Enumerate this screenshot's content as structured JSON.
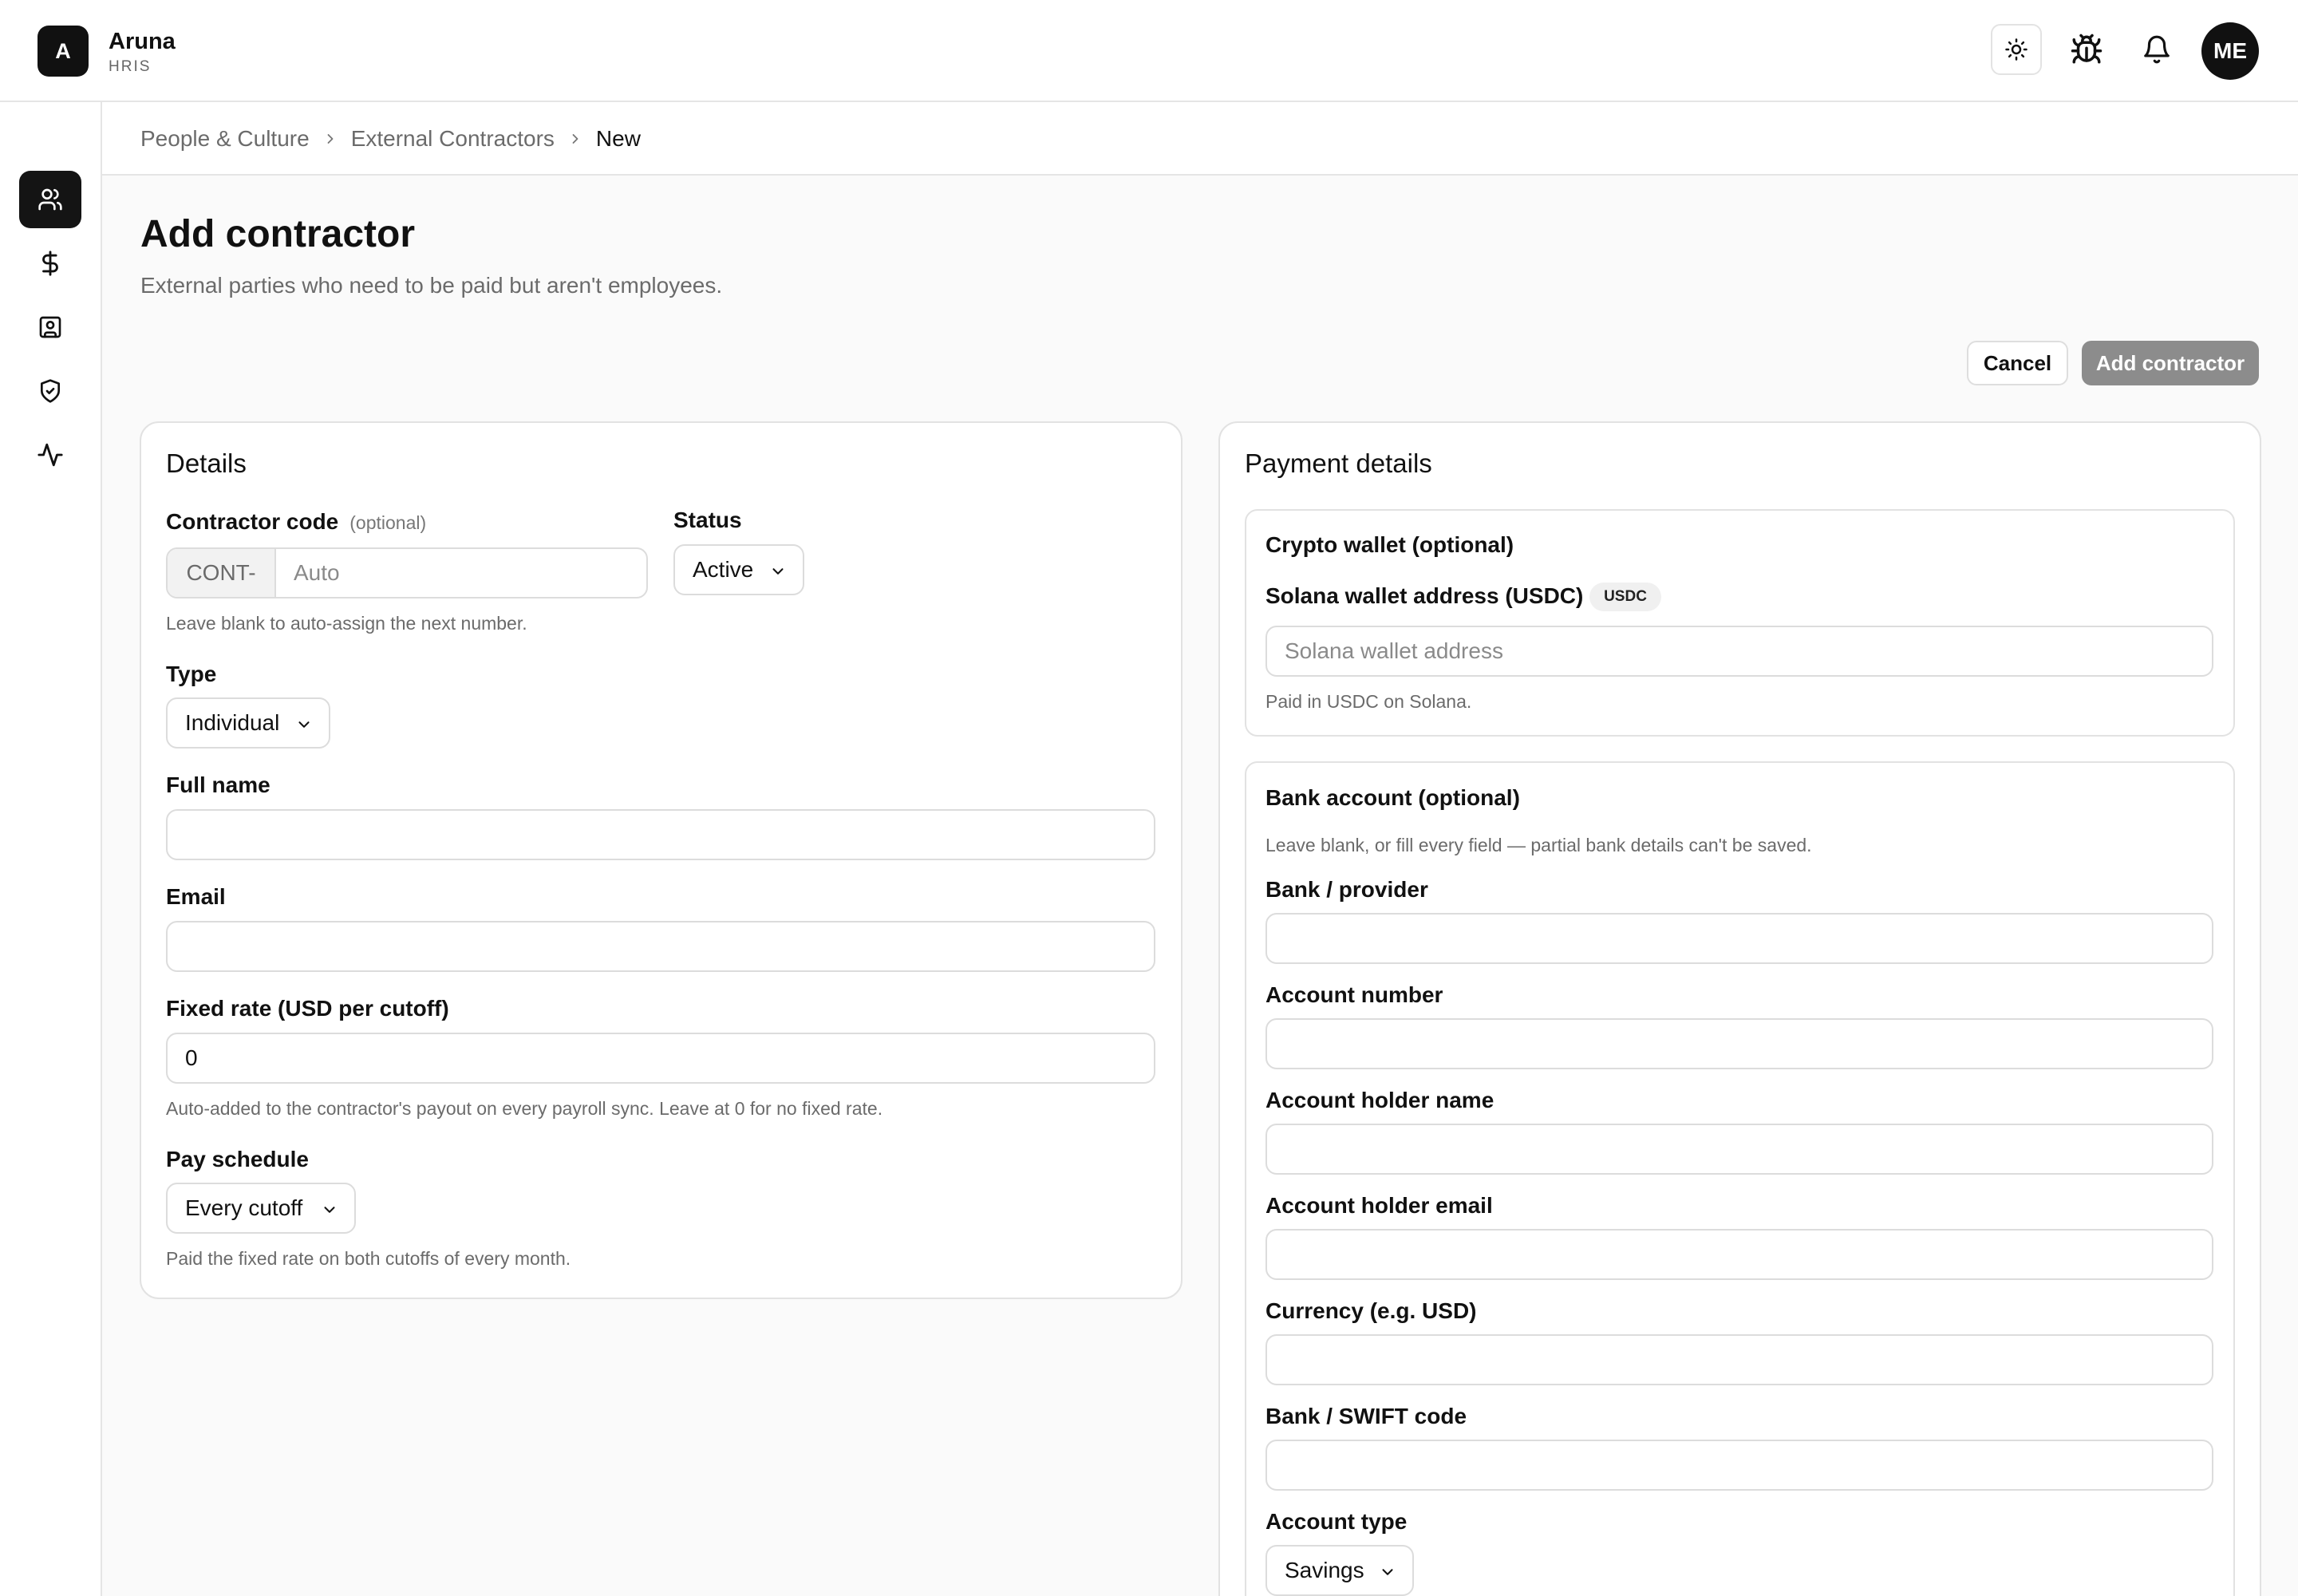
{
  "app": {
    "logo_letter": "A",
    "name": "Aruna",
    "subtitle": "HRIS"
  },
  "topbar": {
    "theme_icon": "sun-icon",
    "bug_icon": "bug-icon",
    "bell_icon": "bell-icon",
    "avatar_initials": "ME"
  },
  "sidebar": {
    "items": [
      {
        "icon": "people-icon",
        "active": true
      },
      {
        "icon": "dollar-icon",
        "active": false
      },
      {
        "icon": "contact-card-icon",
        "active": false
      },
      {
        "icon": "shield-check-icon",
        "active": false
      },
      {
        "icon": "activity-icon",
        "active": false
      }
    ]
  },
  "breadcrumb": {
    "items": [
      "People & Culture",
      "External Contractors",
      "New"
    ]
  },
  "header": {
    "title": "Add contractor",
    "subtitle": "External parties who need to be paid but aren't employees.",
    "cancel_label": "Cancel",
    "submit_label": "Add contractor"
  },
  "details": {
    "title": "Details",
    "code_label": "Contractor code",
    "code_optional": "(optional)",
    "code_prefix": "CONT-",
    "code_placeholder": "Auto",
    "code_help": "Leave blank to auto-assign the next number.",
    "status_label": "Status",
    "status_value": "Active",
    "type_label": "Type",
    "type_value": "Individual",
    "full_name_label": "Full name",
    "full_name_value": "",
    "email_label": "Email",
    "email_value": "",
    "rate_label": "Fixed rate (USD per cutoff)",
    "rate_value": "0",
    "rate_help": "Auto-added to the contractor's payout on every payroll sync. Leave at 0 for no fixed rate.",
    "schedule_label": "Pay schedule",
    "schedule_value": "Every cutoff",
    "schedule_help": "Paid the fixed rate on both cutoffs of every month."
  },
  "payment": {
    "title": "Payment details",
    "crypto": {
      "title": "Crypto wallet (optional)",
      "wallet_label": "Solana wallet address (USDC)",
      "badge": "USDC",
      "wallet_placeholder": "Solana wallet address",
      "help": "Paid in USDC on Solana."
    },
    "bank": {
      "title": "Bank account (optional)",
      "help": "Leave blank, or fill every field — partial bank details can't be saved.",
      "bank_label": "Bank / provider",
      "account_number_label": "Account number",
      "holder_name_label": "Account holder name",
      "holder_email_label": "Account holder email",
      "currency_label": "Currency (e.g. USD)",
      "swift_label": "Bank / SWIFT code",
      "account_type_label": "Account type",
      "account_type_value": "Savings"
    }
  }
}
